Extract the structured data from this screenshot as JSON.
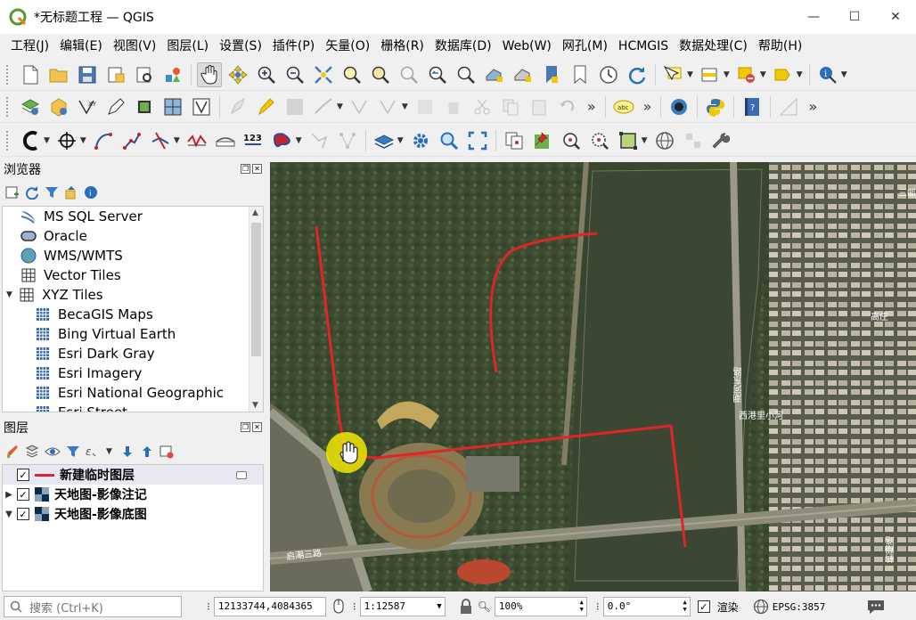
{
  "window": {
    "title": "*无标题工程 — QGIS",
    "minimize": "—",
    "maximize": "☐",
    "close": "✕"
  },
  "menu": [
    "工程(J)",
    "编辑(E)",
    "视图(V)",
    "图层(L)",
    "设置(S)",
    "插件(P)",
    "矢量(O)",
    "栅格(R)",
    "数据库(D)",
    "Web(W)",
    "网孔(M)",
    "HCMGIS",
    "数据处理(C)",
    "帮助(H)"
  ],
  "browser": {
    "title": "浏览器",
    "items": [
      {
        "label": "MS SQL Server",
        "icon": "mssql-icon",
        "indent": 0
      },
      {
        "label": "Oracle",
        "icon": "oracle-icon",
        "indent": 0
      },
      {
        "label": "WMS/WMTS",
        "icon": "globe-icon",
        "indent": 0
      },
      {
        "label": "Vector Tiles",
        "icon": "grid-icon",
        "indent": 0
      },
      {
        "label": "XYZ Tiles",
        "icon": "grid-icon",
        "indent": 0,
        "expanded": true
      },
      {
        "label": "BecaGIS Maps",
        "icon": "tiles-icon",
        "indent": 1
      },
      {
        "label": "Bing Virtual Earth",
        "icon": "tiles-icon",
        "indent": 1
      },
      {
        "label": "Esri Dark Gray",
        "icon": "tiles-icon",
        "indent": 1
      },
      {
        "label": "Esri Imagery",
        "icon": "tiles-icon",
        "indent": 1
      },
      {
        "label": "Esri National Geographic",
        "icon": "tiles-icon",
        "indent": 1
      },
      {
        "label": "Esri Street",
        "icon": "tiles-icon",
        "indent": 1
      }
    ]
  },
  "layers": {
    "title": "图层",
    "items": [
      {
        "label": "新建临时图层",
        "checked": true,
        "expander": "",
        "symbol": "line"
      },
      {
        "label": "天地图-影像注记",
        "checked": true,
        "expander": "▶",
        "symbol": "raster"
      },
      {
        "label": "天地图-影像底图",
        "checked": true,
        "expander": "▼",
        "symbol": "raster"
      }
    ]
  },
  "map": {
    "labels": [
      "启潮三路",
      "潮河东路",
      "西港里小河",
      "高庄",
      "三邮",
      "鹤翔路"
    ]
  },
  "status": {
    "search_placeholder": "搜索 (Ctrl+K)",
    "coordinate": "12133744,4084365",
    "scale": "1:12587",
    "magnifier": "100%",
    "rotation": "0.0°",
    "render_label": "渲染",
    "crs": "EPSG:3857"
  },
  "colors": {
    "accent": "#3b8d3b",
    "line": "#e0242a",
    "highlight": "#f2e600"
  }
}
